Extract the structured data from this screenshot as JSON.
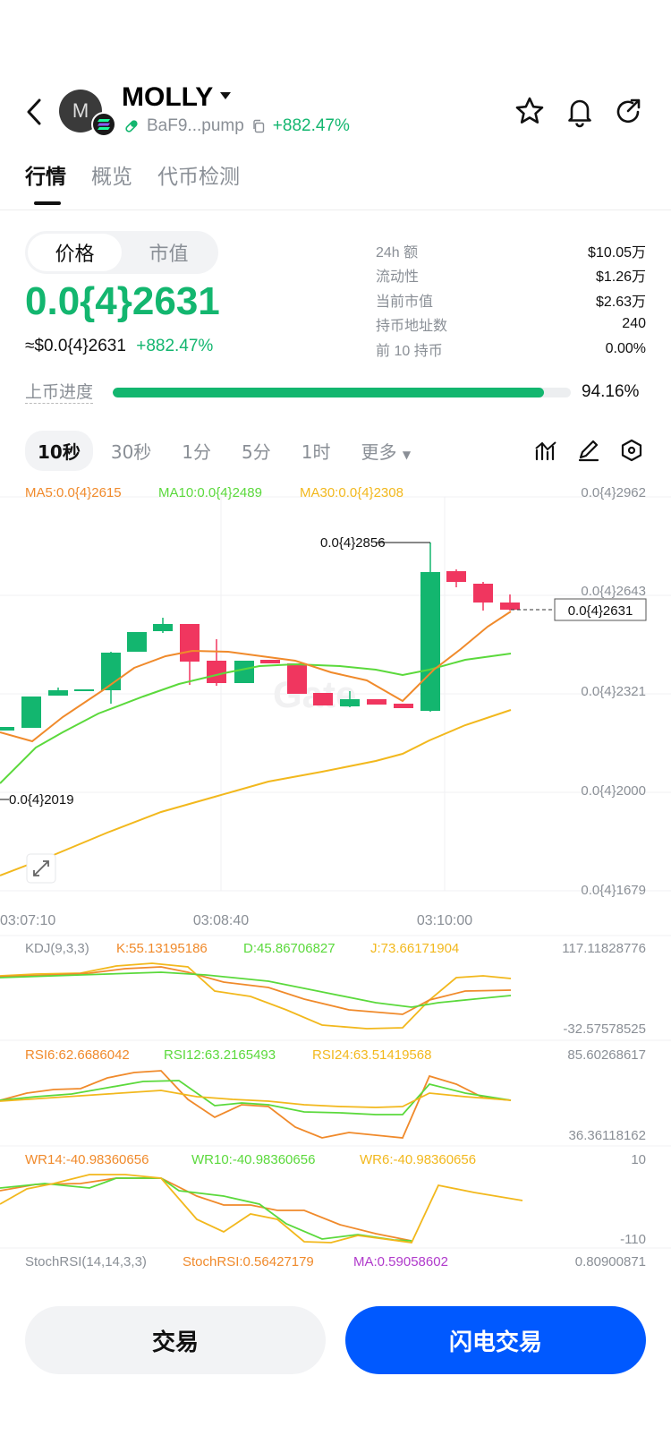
{
  "header": {
    "avatar_letter": "M",
    "token_name": "MOLLY",
    "address": "BaF9...pump",
    "change": "+882.47%"
  },
  "tabs": [
    "行情",
    "概览",
    "代币检测"
  ],
  "price_section": {
    "segments": [
      "价格",
      "市值"
    ],
    "price": "0.0{4}2631",
    "usd_price": "≈$0.0{4}2631",
    "usd_change": "+882.47%"
  },
  "stats": [
    {
      "label": "24h  额",
      "value": "$10.05万"
    },
    {
      "label": "流动性",
      "value": "$1.26万"
    },
    {
      "label": "当前市值",
      "value": "$2.63万"
    },
    {
      "label": "持币地址数",
      "value": "240"
    },
    {
      "label": "前 10 持币",
      "value": "0.00%"
    }
  ],
  "progress": {
    "label": "上币进度",
    "value_text": "94.16%",
    "fraction": 0.9416
  },
  "timeframes": [
    "10秒",
    "30秒",
    "1分",
    "5分",
    "1时",
    "更多"
  ],
  "main_chart": {
    "ma_labels": {
      "ma5": "MA5:0.0{4}2615",
      "ma10": "MA10:0.0{4}2489",
      "ma30": "MA30:0.0{4}2308"
    },
    "y_ticks": [
      "0.0{4}2962",
      "0.0{4}2643",
      "0.0{4}2321",
      "0.0{4}2000",
      "0.0{4}1679"
    ],
    "x_ticks": [
      "03:07:10",
      "03:08:40",
      "03:10:00"
    ],
    "high_label": "0.0{4}2856",
    "low_label": "0.0{4}2019",
    "current_label": "0.0{4}2631",
    "watermark": "Gate"
  },
  "kdj": {
    "title": "KDJ(9,3,3)",
    "k": "K:55.13195186",
    "d": "D:45.86706827",
    "j": "J:73.66171904",
    "max": "117.11828776",
    "min": "-32.57578525"
  },
  "rsi": {
    "rsi6": "RSI6:62.6686042",
    "rsi12": "RSI12:63.2165493",
    "rsi24": "RSI24:63.51419568",
    "max": "85.60268617",
    "min": "36.36118162"
  },
  "wr": {
    "wr14": "WR14:-40.98360656",
    "wr10": "WR10:-40.98360656",
    "wr6": "WR6:-40.98360656",
    "max": "10",
    "min": "-110"
  },
  "stochrsi": {
    "title": "StochRSI(14,14,3,3)",
    "value": "StochRSI:0.56427179",
    "ma": "MA:0.59058602",
    "max": "0.80900871"
  },
  "buttons": {
    "trade": "交易",
    "flash_trade": "闪电交易"
  },
  "colors": {
    "up": "#13b66f",
    "down": "#f0365f",
    "ma5": "#f08a2b",
    "ma10": "#5bd93c",
    "ma30": "#f2b81d",
    "primary": "#0059ff"
  }
}
